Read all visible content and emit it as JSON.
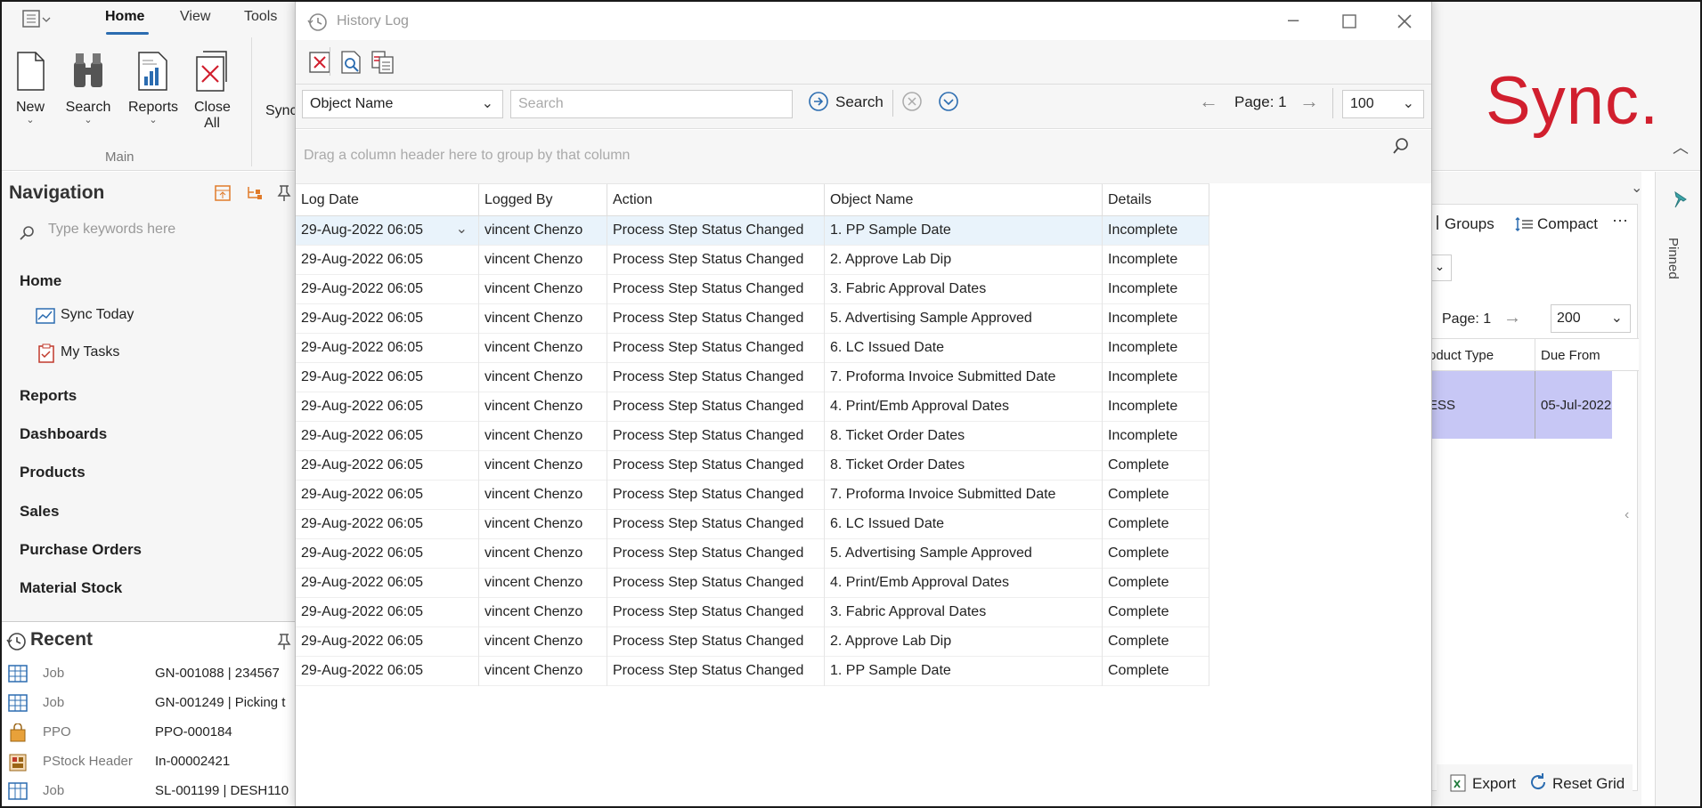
{
  "ribbon": {
    "tabs": [
      "Home",
      "View",
      "Tools"
    ],
    "buttons": [
      {
        "label": "New",
        "icon": "new-document-icon"
      },
      {
        "label": "Search",
        "icon": "binoculars-icon"
      },
      {
        "label": "Reports",
        "icon": "report-chart-icon"
      },
      {
        "label": "Close All",
        "icon": "close-all-icon"
      }
    ],
    "partial_button": "Sync",
    "group_label": "Main",
    "logo_text": "Sync."
  },
  "navigation": {
    "title": "Navigation",
    "search_placeholder": "Type keywords here",
    "sections": [
      {
        "label": "Home",
        "children": [
          "Sync Today",
          "My Tasks"
        ]
      },
      {
        "label": "Reports"
      },
      {
        "label": "Dashboards"
      },
      {
        "label": "Products"
      },
      {
        "label": "Sales"
      },
      {
        "label": "Purchase Orders"
      },
      {
        "label": "Material Stock"
      }
    ]
  },
  "recent": {
    "title": "Recent",
    "items": [
      {
        "type": "Job",
        "value": "GN-001088 | 234567"
      },
      {
        "type": "Job",
        "value": "GN-001249 | Picking t"
      },
      {
        "type": "PPO",
        "value": "PPO-000184"
      },
      {
        "type": "PStock Header",
        "value": "In-00002421"
      },
      {
        "type": "Job",
        "value": "SL-001199 | DESH110"
      }
    ]
  },
  "background_panel": {
    "groups_label": "Groups",
    "compact_label": "Compact",
    "page_label": "Page: 1",
    "page_size": "200",
    "col_product_type": "oduct Type",
    "col_due_from": "Due From",
    "row_product_type": "ESS",
    "row_due_from": "05-Jul-2022",
    "export_label": "Export",
    "reset_grid_label": "Reset Grid",
    "pinned_label": "Pinned"
  },
  "dialog": {
    "title": "History Log",
    "filter_field": "Object Name",
    "search_placeholder": "Search",
    "search_button": "Search",
    "page_label": "Page: 1",
    "page_size": "100",
    "group_hint": "Drag a column header here to group by that column",
    "columns": [
      "Log Date",
      "Logged By",
      "Action",
      "Object Name",
      "Details"
    ],
    "rows": [
      [
        "29-Aug-2022 06:05",
        "vincent Chenzo",
        "Process Step Status Changed",
        "1. PP Sample Date",
        "Incomplete"
      ],
      [
        "29-Aug-2022 06:05",
        "vincent Chenzo",
        "Process Step Status Changed",
        "2. Approve Lab Dip",
        "Incomplete"
      ],
      [
        "29-Aug-2022 06:05",
        "vincent Chenzo",
        "Process Step Status Changed",
        "3. Fabric Approval Dates",
        "Incomplete"
      ],
      [
        "29-Aug-2022 06:05",
        "vincent Chenzo",
        "Process Step Status Changed",
        "5. Advertising Sample Approved",
        "Incomplete"
      ],
      [
        "29-Aug-2022 06:05",
        "vincent Chenzo",
        "Process Step Status Changed",
        "6. LC Issued Date",
        "Incomplete"
      ],
      [
        "29-Aug-2022 06:05",
        "vincent Chenzo",
        "Process Step Status Changed",
        "7. Proforma Invoice Submitted Date",
        "Incomplete"
      ],
      [
        "29-Aug-2022 06:05",
        "vincent Chenzo",
        "Process Step Status Changed",
        "4. Print/Emb Approval Dates",
        "Incomplete"
      ],
      [
        "29-Aug-2022 06:05",
        "vincent Chenzo",
        "Process Step Status Changed",
        "8. Ticket Order Dates",
        "Incomplete"
      ],
      [
        "29-Aug-2022 06:05",
        "vincent Chenzo",
        "Process Step Status Changed",
        "8. Ticket Order Dates",
        "Complete"
      ],
      [
        "29-Aug-2022 06:05",
        "vincent Chenzo",
        "Process Step Status Changed",
        "7. Proforma Invoice Submitted Date",
        "Complete"
      ],
      [
        "29-Aug-2022 06:05",
        "vincent Chenzo",
        "Process Step Status Changed",
        "6. LC Issued Date",
        "Complete"
      ],
      [
        "29-Aug-2022 06:05",
        "vincent Chenzo",
        "Process Step Status Changed",
        "5. Advertising Sample Approved",
        "Complete"
      ],
      [
        "29-Aug-2022 06:05",
        "vincent Chenzo",
        "Process Step Status Changed",
        "4. Print/Emb Approval Dates",
        "Complete"
      ],
      [
        "29-Aug-2022 06:05",
        "vincent Chenzo",
        "Process Step Status Changed",
        "3. Fabric Approval Dates",
        "Complete"
      ],
      [
        "29-Aug-2022 06:05",
        "vincent Chenzo",
        "Process Step Status Changed",
        "2. Approve Lab Dip",
        "Complete"
      ],
      [
        "29-Aug-2022 06:05",
        "vincent Chenzo",
        "Process Step Status Changed",
        "1. PP Sample Date",
        "Complete"
      ]
    ]
  },
  "colors": {
    "accent": "#2b6cb0",
    "logo": "#d11f2e",
    "selected_row": "#e9f3fb",
    "highlight_row": "#c7c7f5"
  }
}
